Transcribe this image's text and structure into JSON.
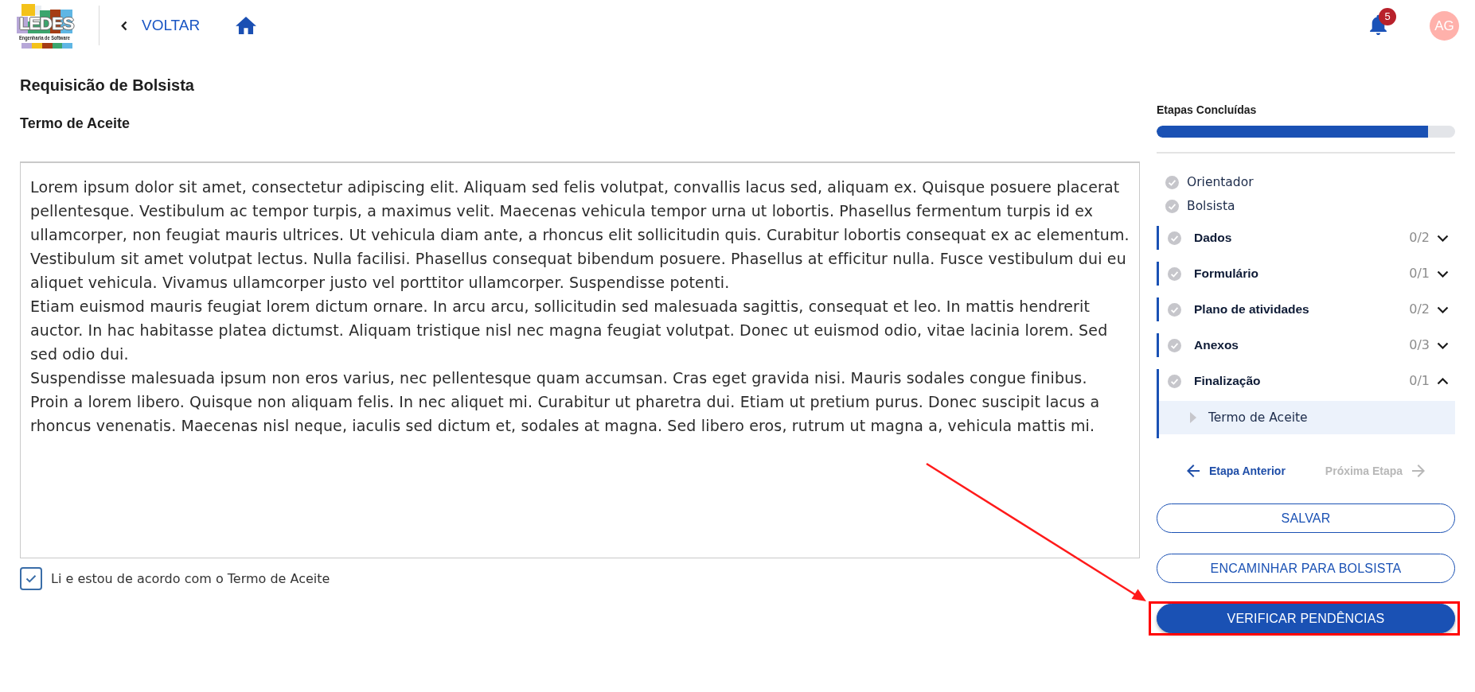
{
  "header": {
    "logo": {
      "wordmark": "LEDES",
      "tagline": "Engenharia de Software"
    },
    "back_link": {
      "label": "VOLTAR"
    },
    "notifications": {
      "count": "5"
    },
    "avatar": {
      "initials": "AG"
    }
  },
  "form": {
    "title": "Requisicão de Bolsista",
    "section_title": "Termo de Aceite",
    "terms": {
      "paragraphs": [
        "Lorem ipsum dolor sit amet, consectetur adipiscing elit. Aliquam sed felis volutpat, convallis lacus sed, aliquam ex. Quisque posuere placerat pellentesque. Vestibulum ac tempor turpis, a maximus velit. Maecenas vehicula tempor urna ut lobortis. Phasellus fermentum turpis id ex ullamcorper, non feugiat mauris ultrices. Ut vehicula diam ante, a rhoncus elit sollicitudin quis. Curabitur lobortis consequat ex ac elementum. Vestibulum sit amet volutpat lectus. Nulla facilisi. Phasellus consequat bibendum posuere. Phasellus at efficitur nulla. Fusce vestibulum dui eu aliquet vehicula. Vivamus ullamcorper justo vel porttitor ullamcorper. Suspendisse potenti.",
        "Etiam euismod mauris feugiat lorem dictum ornare. In arcu arcu, sollicitudin sed malesuada sagittis, consequat et leo. In mattis hendrerit auctor. In hac habitasse platea dictumst. Aliquam tristique nisl nec magna feugiat volutpat. Donec ut euismod odio, vitae lacinia lorem. Sed sed odio dui.",
        "Suspendisse malesuada ipsum non eros varius, nec pellentesque quam accumsan. Cras eget gravida nisi. Mauris sodales congue finibus. Proin a lorem libero. Quisque non aliquam felis. In nec aliquet mi. Curabitur ut pharetra dui. Etiam ut pretium purus. Donec suscipit lacus a rhoncus venenatis. Maecenas nisl neque, iaculis sed dictum et, sodales at magna. Sed libero eros, rutrum ut magna a, vehicula mattis mi."
      ]
    },
    "agreement": {
      "label": "Li e estou de acordo com o Termo de Aceite",
      "checked": true
    }
  },
  "steps_panel": {
    "title": "Etapas Concluídas",
    "progress": {
      "level": 0.91
    },
    "steps": [
      {
        "kind": "item",
        "label": "Orientador"
      },
      {
        "kind": "item",
        "label": "Bolsista"
      },
      {
        "kind": "group",
        "label": "Dados",
        "count": "0/2",
        "expanded": false
      },
      {
        "kind": "group",
        "label": "Formulário",
        "count": "0/1",
        "expanded": false
      },
      {
        "kind": "group",
        "label": "Plano de atividades",
        "count": "0/2",
        "expanded": false
      },
      {
        "kind": "group",
        "label": "Anexos",
        "count": "0/3",
        "expanded": false
      },
      {
        "kind": "group",
        "label": "Finalização",
        "count": "0/1",
        "expanded": true,
        "children": [
          {
            "label": "Termo de Aceite",
            "selected": true
          }
        ]
      }
    ],
    "navigation": [
      {
        "kind": "previous",
        "label": "Etapa Anterior",
        "disabled": false
      },
      {
        "kind": "next",
        "label": "Próxima Etapa",
        "disabled": true
      }
    ],
    "actions": [
      {
        "kind": "outline",
        "label": "SALVAR",
        "highlighted": false
      },
      {
        "kind": "outline",
        "label": "ENCAMINHAR PARA BOLSISTA",
        "highlighted": false
      },
      {
        "kind": "filled",
        "label": "VERIFICAR PENDÊNCIAS",
        "highlighted": true
      }
    ]
  }
}
